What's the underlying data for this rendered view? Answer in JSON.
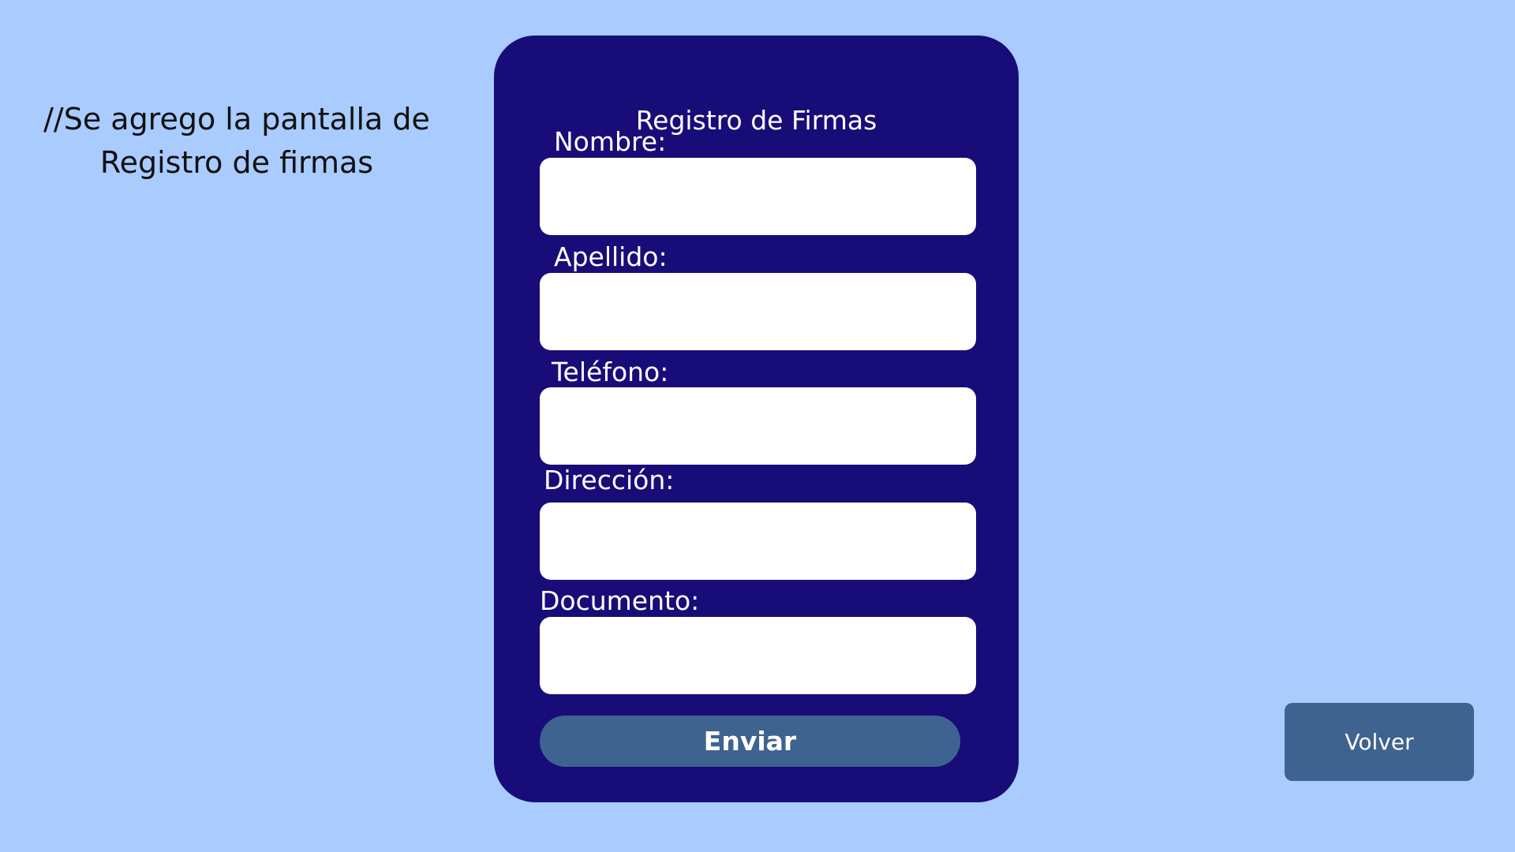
{
  "note": {
    "line1": "//Se agrego la pantalla de",
    "line2": "Registro de firmas"
  },
  "form": {
    "title": "Registro de Firmas",
    "fields": [
      {
        "label": "Nombre:",
        "value": ""
      },
      {
        "label": "Apellido:",
        "value": ""
      },
      {
        "label": "Teléfono:",
        "value": ""
      },
      {
        "label": "Dirección:",
        "value": ""
      },
      {
        "label": "Documento:",
        "value": ""
      }
    ],
    "submit_label": "Enviar"
  },
  "back_label": "Volver",
  "colors": {
    "background": "#a9cbfd",
    "card": "#180d78",
    "button": "#3f6390",
    "input": "#ffffff"
  }
}
